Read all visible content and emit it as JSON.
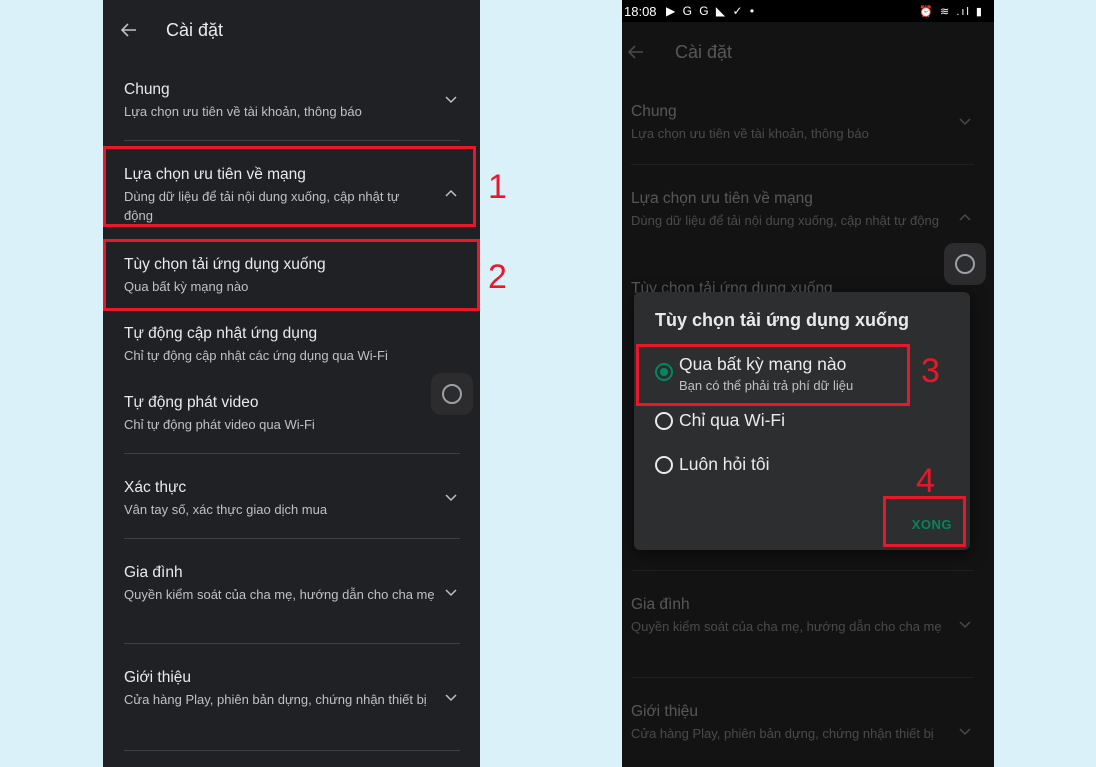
{
  "left": {
    "title": "Cài đặt",
    "items": [
      {
        "title": "Chung",
        "subtitle": "Lựa chọn ưu tiên về tài khoản, thông báo"
      },
      {
        "title": "Lựa chọn ưu tiên về mạng",
        "subtitle": "Dùng dữ liệu để tải nội dung xuống, cập nhật tự động"
      },
      {
        "title": "Tùy chọn tải ứng dụng xuống",
        "subtitle": "Qua bất kỳ mạng nào"
      },
      {
        "title": "Tự động cập nhật ứng dụng",
        "subtitle": "Chỉ tự động cập nhật các ứng dụng qua Wi-Fi"
      },
      {
        "title": "Tự động phát video",
        "subtitle": "Chỉ tự động phát video qua Wi-Fi"
      },
      {
        "title": "Xác thực",
        "subtitle": "Vân tay số, xác thực giao dịch mua"
      },
      {
        "title": "Gia đình",
        "subtitle": "Quyền kiểm soát của cha mẹ, hướng dẫn cho cha mẹ"
      },
      {
        "title": "Giới thiệu",
        "subtitle": "Cửa hàng Play, phiên bản dựng, chứng nhận thiết bị"
      }
    ],
    "step1": "1",
    "step2": "2"
  },
  "right": {
    "status_time": "18:08",
    "status_left_icons": "▶ G G ◣ ✓ •",
    "status_right_icons": "⏰ ≋ .ıl ▮",
    "title": "Cài đặt",
    "bg_items": [
      {
        "title": "Chung",
        "subtitle": "Lựa chọn ưu tiên về tài khoản, thông báo"
      },
      {
        "title": "Lựa chọn ưu tiên về mạng",
        "subtitle": "Dùng dữ liệu để tải nội dung xuống, cập nhật tự động"
      },
      {
        "title": "Tùy chọn tải ứng dụng xuống"
      },
      {
        "title": "Gia đình",
        "subtitle": "Quyền kiểm soát của cha mẹ, hướng dẫn cho cha mẹ"
      },
      {
        "title": "Giới thiệu",
        "subtitle": "Cửa hàng Play, phiên bản dựng, chứng nhận thiết bị"
      }
    ],
    "dialog": {
      "title": "Tùy chọn tải ứng dụng xuống",
      "options": [
        {
          "label": "Qua bất kỳ mạng nào",
          "sub": "Bạn có thể phải trả phí dữ liệu",
          "selected": true
        },
        {
          "label": "Chỉ qua Wi-Fi",
          "selected": false
        },
        {
          "label": "Luôn hỏi tôi",
          "selected": false
        }
      ],
      "done": "XONG"
    },
    "step3": "3",
    "step4": "4"
  },
  "colors": {
    "accent": "#01875f",
    "highlight": "#e8182a",
    "background": "#dbf1fa"
  }
}
